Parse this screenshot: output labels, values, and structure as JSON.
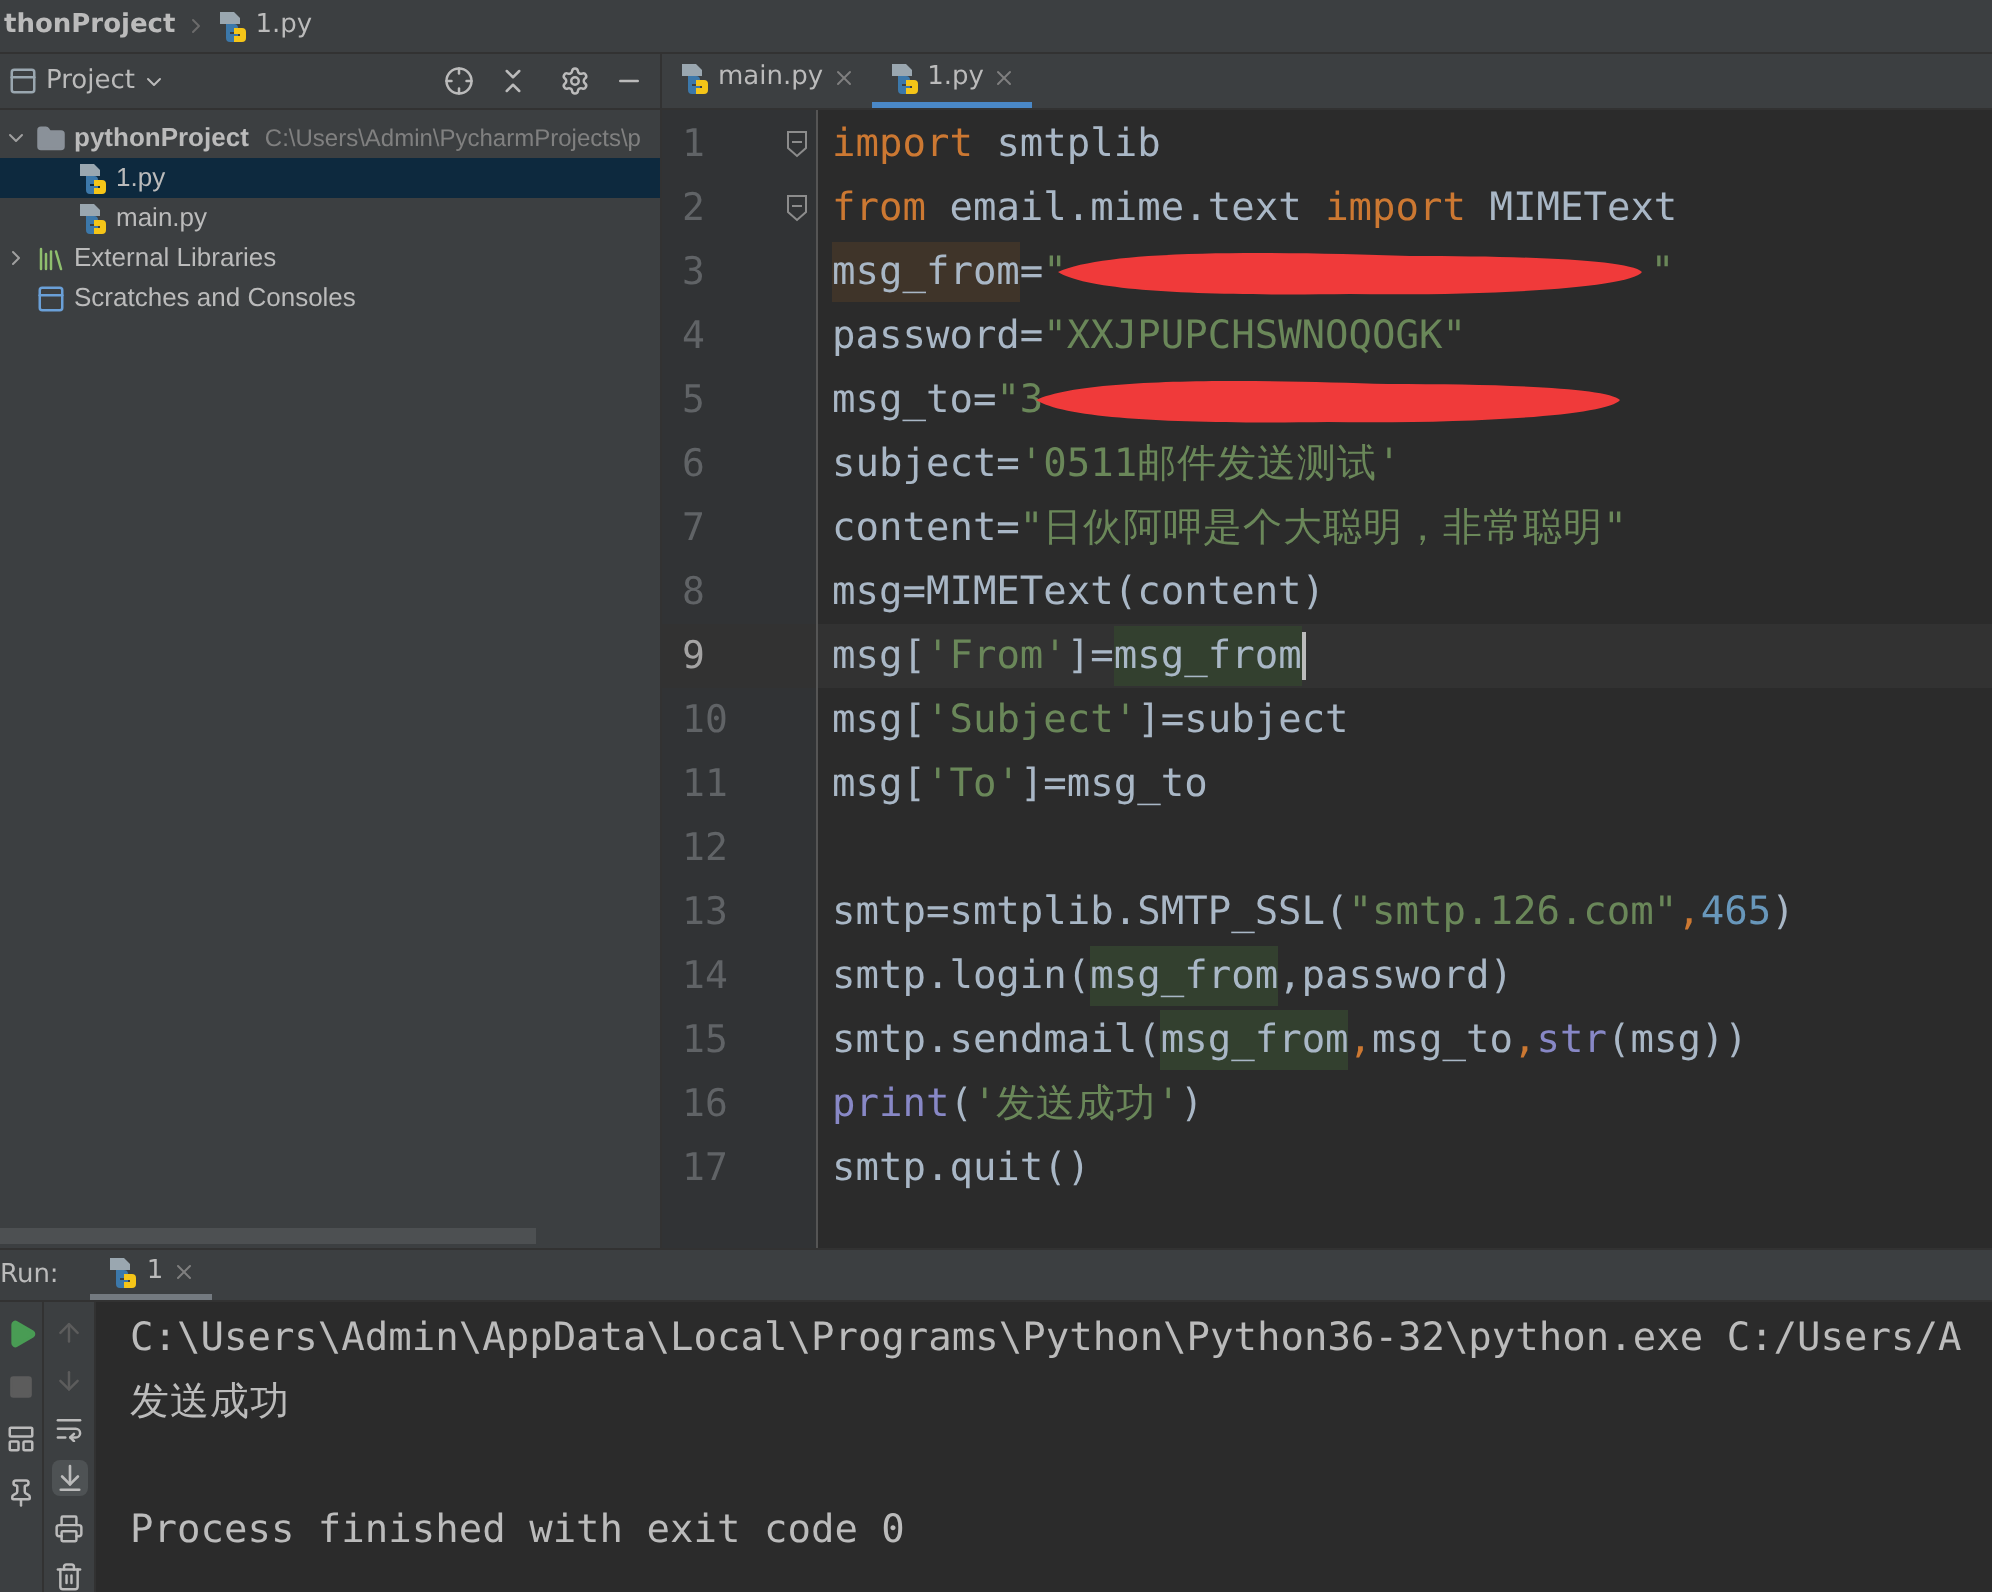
{
  "breadcrumb": [
    "thonProject",
    "1.py"
  ],
  "project_panel": {
    "title": "Project",
    "tree": [
      {
        "label": "pythonProject",
        "path": "C:\\Users\\Admin\\PycharmProjects\\p",
        "kind": "folder",
        "expanded": true,
        "selected": false,
        "children": [
          {
            "label": "1.py",
            "kind": "python",
            "selected": true
          },
          {
            "label": "main.py",
            "kind": "python",
            "selected": false
          }
        ]
      },
      {
        "label": "External Libraries",
        "kind": "libraries",
        "expanded": false,
        "selected": false
      },
      {
        "label": "Scratches and Consoles",
        "kind": "scratches",
        "selected": false
      }
    ]
  },
  "editor_tabs": [
    {
      "label": "main.py",
      "selected": false
    },
    {
      "label": "1.py",
      "selected": true
    }
  ],
  "code_lines": [
    {
      "number": "1",
      "current": false,
      "fold": true,
      "tokens": [
        {
          "text": "import",
          "kind": "keyword"
        },
        {
          "text": " smtplib",
          "kind": "plain"
        }
      ]
    },
    {
      "number": "2",
      "current": false,
      "fold": true,
      "tokens": [
        {
          "text": "from",
          "kind": "keyword"
        },
        {
          "text": " email.mime.text ",
          "kind": "plain"
        },
        {
          "text": "import",
          "kind": "keyword"
        },
        {
          "text": " MIMEText",
          "kind": "plain"
        }
      ]
    },
    {
      "number": "3",
      "current": false,
      "fold": false,
      "tokens": [
        {
          "text": "msg_from",
          "kind": "plain",
          "highlighted": true,
          "write": true
        },
        {
          "text": "=",
          "kind": "plain"
        },
        {
          "text": "\"",
          "kind": "string"
        },
        {
          "kind": "redaction"
        },
        {
          "text": "\"",
          "kind": "string"
        }
      ]
    },
    {
      "number": "4",
      "current": false,
      "fold": false,
      "tokens": [
        {
          "text": "password=",
          "kind": "plain"
        },
        {
          "text": "\"XXJPUPCHSWNOQOGK\"",
          "kind": "string"
        }
      ]
    },
    {
      "number": "5",
      "current": false,
      "fold": false,
      "tokens": [
        {
          "text": "msg_to=",
          "kind": "plain"
        },
        {
          "text": "\"3",
          "kind": "string"
        },
        {
          "kind": "redaction"
        }
      ]
    },
    {
      "number": "6",
      "current": false,
      "fold": false,
      "tokens": [
        {
          "text": "subject=",
          "kind": "plain"
        },
        {
          "text": "'0511邮件发送测试'",
          "kind": "string"
        }
      ]
    },
    {
      "number": "7",
      "current": false,
      "fold": false,
      "tokens": [
        {
          "text": "content=",
          "kind": "plain"
        },
        {
          "text": "\"日伙阿呷是个大聪明，非常聪明\"",
          "kind": "string"
        }
      ]
    },
    {
      "number": "8",
      "current": false,
      "fold": false,
      "tokens": [
        {
          "text": "msg=MIMEText(content)",
          "kind": "plain"
        }
      ]
    },
    {
      "number": "9",
      "current": true,
      "fold": false,
      "tokens": [
        {
          "text": "msg[",
          "kind": "plain"
        },
        {
          "text": "'From'",
          "kind": "string"
        },
        {
          "text": "]=",
          "kind": "plain"
        },
        {
          "text": "msg_from",
          "kind": "plain",
          "highlighted": true,
          "write": false
        }
      ]
    },
    {
      "number": "10",
      "current": false,
      "fold": false,
      "tokens": [
        {
          "text": "msg[",
          "kind": "plain"
        },
        {
          "text": "'Subject'",
          "kind": "string"
        },
        {
          "text": "]=subject",
          "kind": "plain"
        }
      ]
    },
    {
      "number": "11",
      "current": false,
      "fold": false,
      "tokens": [
        {
          "text": "msg[",
          "kind": "plain"
        },
        {
          "text": "'To'",
          "kind": "string"
        },
        {
          "text": "]=msg_to",
          "kind": "plain"
        }
      ]
    },
    {
      "number": "12",
      "current": false,
      "fold": false
    },
    {
      "number": "13",
      "current": false,
      "fold": false,
      "tokens": [
        {
          "text": "smtp=smtplib.SMTP_SSL(",
          "kind": "plain"
        },
        {
          "text": "\"smtp.126.com\"",
          "kind": "string"
        },
        {
          "text": ",",
          "kind": "keyword"
        },
        {
          "text": "465",
          "kind": "number"
        },
        {
          "text": ")",
          "kind": "plain"
        }
      ]
    },
    {
      "number": "14",
      "current": false,
      "fold": false,
      "tokens": [
        {
          "text": "smtp.login(",
          "kind": "plain"
        },
        {
          "text": "msg_from",
          "kind": "plain",
          "highlighted": true,
          "write": false
        },
        {
          "text": ",password)",
          "kind": "plain"
        }
      ]
    },
    {
      "number": "15",
      "current": false,
      "fold": false,
      "tokens": [
        {
          "text": "smtp.sendmail(",
          "kind": "plain"
        },
        {
          "text": "msg_from",
          "kind": "plain",
          "highlighted": true,
          "write": false
        },
        {
          "text": ",",
          "kind": "keyword"
        },
        {
          "text": "msg_to",
          "kind": "plain"
        },
        {
          "text": ",",
          "kind": "keyword"
        },
        {
          "text": "str",
          "kind": "builtin"
        },
        {
          "text": "(msg))",
          "kind": "plain"
        }
      ]
    },
    {
      "number": "16",
      "current": false,
      "fold": false,
      "tokens": [
        {
          "text": "print",
          "kind": "builtin"
        },
        {
          "text": "(",
          "kind": "plain"
        },
        {
          "text": "'发送成功'",
          "kind": "string"
        },
        {
          "text": ")",
          "kind": "plain"
        }
      ]
    },
    {
      "number": "17",
      "current": false,
      "fold": false,
      "tokens": [
        {
          "text": "smtp.quit()",
          "kind": "plain"
        }
      ]
    }
  ],
  "run_panel": {
    "label": "Run:",
    "tabs": [
      {
        "label": "1",
        "selected": true
      }
    ],
    "console": [
      {
        "text": "C:\\Users\\Admin\\AppData\\Local\\Programs\\Python\\Python36-32\\python.exe C:/Users/A",
        "kind": "command"
      },
      {
        "text": "发送成功",
        "kind": "output"
      },
      {
        "text": "Process finished with exit code 0",
        "kind": "status"
      }
    ]
  }
}
